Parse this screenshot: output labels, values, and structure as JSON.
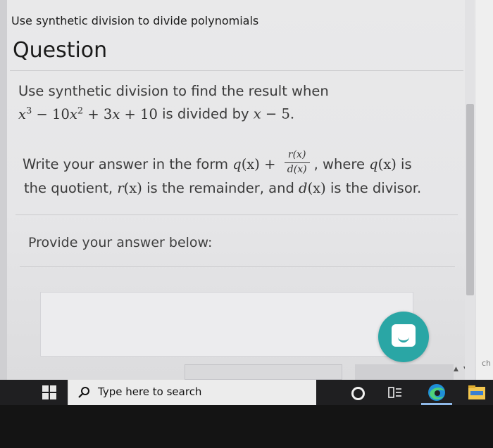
{
  "page": {
    "assignment_title": "Use synthetic division to divide polynomials",
    "heading": "Question"
  },
  "question": {
    "line1": "Use synthetic division to find the result when",
    "poly": {
      "x1": "x",
      "exp3": "3",
      "minus1": " − ",
      "coef10": "10",
      "x2": "x",
      "exp2": "2",
      "plus1": " + ",
      "coef3": "3",
      "x3": "x",
      "plus2": " + ",
      "const10": "10"
    },
    "divided_by": " is divided by ",
    "divisor": {
      "x": "x",
      "minus": " − ",
      "five": "5",
      "period": "."
    },
    "write_prefix": "Write your answer in the form ",
    "form": {
      "q": "q",
      "qx": "(x)",
      "plus": " + ",
      "num": "r(x)",
      "den": "d(x)"
    },
    "where": ", where ",
    "where_q": "q",
    "where_qx": "(x)",
    "is": " is",
    "line4": {
      "text1": "the quotient, ",
      "r": "r",
      "rx": "(x)",
      "text2": " is the remainder, and ",
      "d": "d",
      "dx": "(x)",
      "text3": " is the divisor."
    }
  },
  "answer": {
    "prompt": "Provide your answer below:"
  },
  "side": {
    "sliver_text": "ch"
  },
  "taskbar": {
    "search_placeholder": "Type here to search"
  },
  "colors": {
    "chat_button": "#2aa6a5",
    "taskbar": "#1f1f21"
  },
  "icons": [
    "windows-logo-icon",
    "search-icon",
    "cortana-icon",
    "task-view-icon",
    "edge-icon",
    "file-explorer-icon",
    "chat-icon"
  ]
}
